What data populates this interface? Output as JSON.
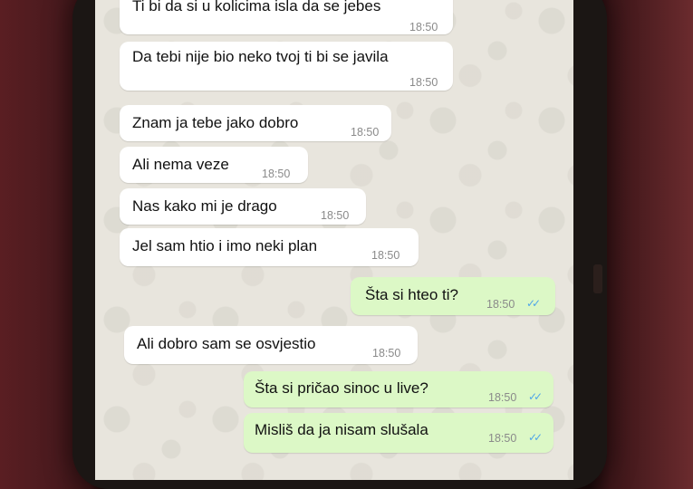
{
  "chat": {
    "messages": [
      {
        "text": "Ti bi da si u kolicima isla da se jebes",
        "time": "18:50",
        "side": "in"
      },
      {
        "text": "Da tebi nije bio neko tvoj ti bi se javila",
        "time": "18:50",
        "side": "in"
      },
      {
        "text": "Znam ja tebe jako dobro",
        "time": "18:50",
        "side": "in"
      },
      {
        "text": "Ali nema veze",
        "time": "18:50",
        "side": "in"
      },
      {
        "text": "Nas kako mi je drago",
        "time": "18:50",
        "side": "in"
      },
      {
        "text": "Jel sam htio i imo neki plan",
        "time": "18:50",
        "side": "in"
      },
      {
        "text": "Šta si hteo ti?",
        "time": "18:50",
        "side": "out",
        "ticks": "✓✓"
      },
      {
        "text": "Ali dobro sam se osvjestio",
        "time": "18:50",
        "side": "in"
      },
      {
        "text": "Šta si pričao sinoc u live?",
        "time": "18:50",
        "side": "out",
        "ticks": "✓✓"
      },
      {
        "text": "Misliš da ja nisam slušala",
        "time": "18:50",
        "side": "out",
        "ticks": "✓✓"
      }
    ]
  },
  "colors": {
    "incoming_bubble": "#ffffff",
    "outgoing_bubble": "#dcf8c6",
    "read_ticks": "#4fa6e8",
    "chat_background": "#e8e5dd"
  }
}
